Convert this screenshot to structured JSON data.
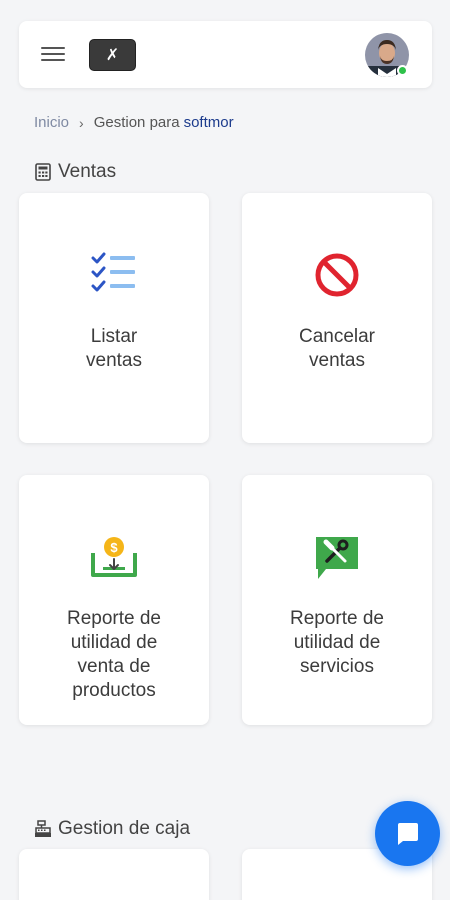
{
  "header": {
    "logo_text": "✗"
  },
  "breadcrumb": {
    "home": "Inicio",
    "separator": "›",
    "current": "Gestion para",
    "company": "softmor"
  },
  "sections": {
    "ventas": {
      "title": "Ventas",
      "cards": [
        {
          "label": "Listar ventas"
        },
        {
          "label": "Cancelar ventas"
        },
        {
          "label": "Reporte de utilidad de venta de productos"
        },
        {
          "label": "Reporte de utilidad de servicios"
        }
      ]
    },
    "caja": {
      "title": "Gestion de caja"
    }
  },
  "colors": {
    "accent": "#1976f0",
    "breadcrumb_company": "#1c3b8c",
    "cancel_red": "#e0242f",
    "check_blue": "#2c55c5",
    "report_green": "#3fa84b",
    "coin_yellow": "#f5b518"
  }
}
